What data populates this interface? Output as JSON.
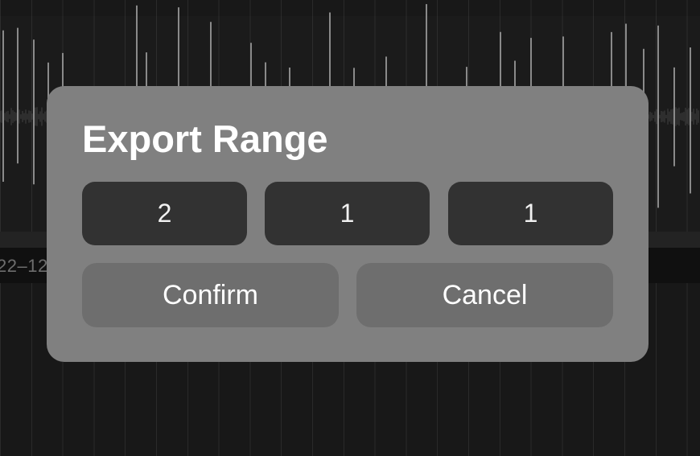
{
  "background": {
    "timestamp_text": "22–12"
  },
  "dialog": {
    "title": "Export Range",
    "fields": [
      {
        "value": "2"
      },
      {
        "value": "1"
      },
      {
        "value": "1"
      }
    ],
    "confirm_label": "Confirm",
    "cancel_label": "Cancel"
  },
  "colors": {
    "page_background": "#181818",
    "dialog_background": "#808080",
    "field_background": "#323232",
    "button_background": "#6e6e6e",
    "text": "#ffffff",
    "waveform": "#8a8a8a"
  }
}
